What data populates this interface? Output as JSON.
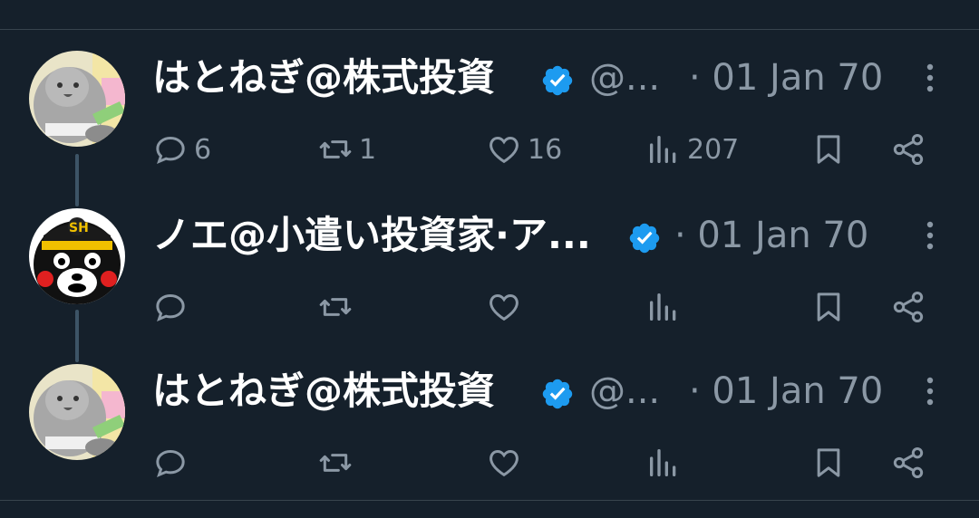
{
  "tweets": [
    {
      "name": "はとねぎ@株式投資",
      "handle": "@...",
      "date": "· 01 Jan 70",
      "avatar_icon": "pigeon-avatar",
      "counts": {
        "reply": "6",
        "retweet": "1",
        "like": "16",
        "views": "207"
      }
    },
    {
      "name": "ノエ@小遣い投資家·ア...",
      "handle": "",
      "date": "· 01 Jan 70",
      "avatar_icon": "kumamon-avatar",
      "counts": {
        "reply": "",
        "retweet": "",
        "like": "",
        "views": ""
      }
    },
    {
      "name": "はとねぎ@株式投資",
      "handle": "@...",
      "date": "· 01 Jan 70",
      "avatar_icon": "pigeon-avatar",
      "counts": {
        "reply": "",
        "retweet": "",
        "like": "",
        "views": ""
      }
    }
  ],
  "colors": {
    "background": "#15202b",
    "muted_text": "#8b98a5",
    "verified_blue": "#1d9bf0",
    "thread_line": "#3d5466"
  },
  "icons": [
    "reply-icon",
    "retweet-icon",
    "like-icon",
    "views-icon",
    "bookmark-icon",
    "share-icon",
    "more-icon",
    "verified-badge-icon"
  ]
}
